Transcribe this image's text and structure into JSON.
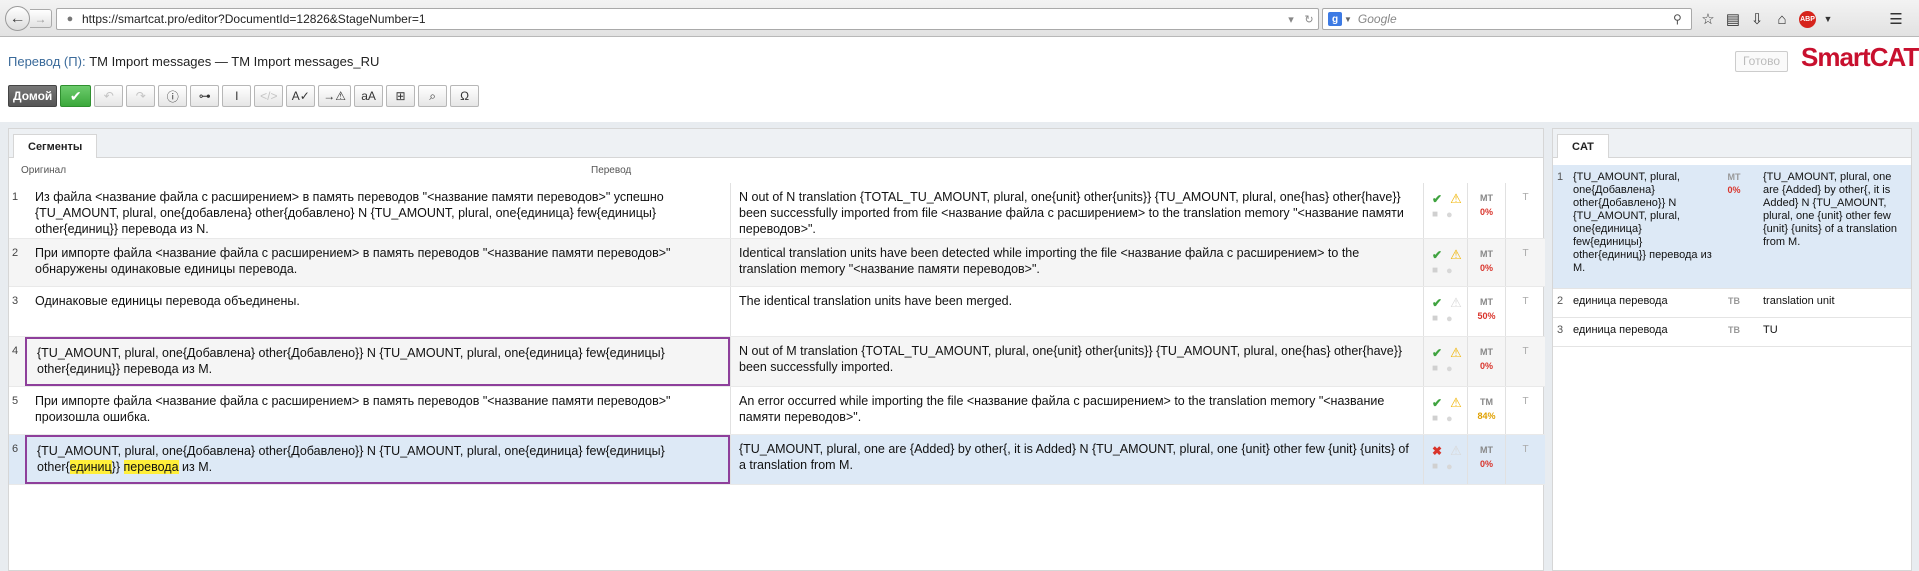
{
  "browser": {
    "url": "https://smartcat.pro/editor?DocumentId=12826&StageNumber=1",
    "search_placeholder": "Google",
    "search_engine_letter": "g",
    "addon_label": "ABP"
  },
  "header": {
    "mode_label": "Перевод (П):",
    "document_title": "TM Import messages — TM Import messages_RU",
    "done_label": "Готово",
    "logo_text": "SmartCAT"
  },
  "toolbar": {
    "home_label": "Домой",
    "confirm_icon": "checkmark-icon",
    "tools": [
      {
        "name": "undo-button",
        "glyph": "↶",
        "disabled": true
      },
      {
        "name": "redo-button",
        "glyph": "↷",
        "disabled": true
      },
      {
        "name": "info-button",
        "glyph": "ⓘ",
        "disabled": false
      },
      {
        "name": "key-button",
        "glyph": "⊶",
        "disabled": false
      },
      {
        "name": "insert-cursor-button",
        "glyph": "I",
        "disabled": false
      },
      {
        "name": "insert-tag-button",
        "glyph": "</>",
        "disabled": true
      },
      {
        "name": "spellcheck-button",
        "glyph": "A✓",
        "disabled": false
      },
      {
        "name": "qa-check-button",
        "glyph": "→⚠",
        "disabled": false
      },
      {
        "name": "change-case-button",
        "glyph": "aA",
        "disabled": false
      },
      {
        "name": "add-term-button",
        "glyph": "⊞",
        "disabled": false
      },
      {
        "name": "concordance-button",
        "glyph": "⌕",
        "disabled": false
      },
      {
        "name": "special-char-button",
        "glyph": "Ω",
        "disabled": false
      }
    ]
  },
  "segments_panel": {
    "tab_label": "Сегменты",
    "col_source": "Оригинал",
    "col_target": "Перевод",
    "rows": [
      {
        "num": "1",
        "source": "Из файла <название файла с расширением> в память переводов \"<название памяти переводов>\" успешно {TU_AMOUNT, plural, one{добавлена} other{добавлено} N {TU_AMOUNT, plural, one{единица} few{единицы} other{единиц}} перевода из N.",
        "target": "N out of N translation {TOTAL_TU_AMOUNT, plural, one{unit} other{units}} {TU_AMOUNT, plural, one{has} other{have}} been successfully imported from file <название файла с расширением> to the translation memory \"<название памяти переводов>\".",
        "status": "ok",
        "warning": true,
        "match_type": "MT",
        "match_value": "0%",
        "match_color": "red",
        "t": "T"
      },
      {
        "num": "2",
        "source": "При импорте файла <название файла с расширением> в память переводов \"<название памяти переводов>\" обнаружены одинаковые единицы перевода.",
        "target": "Identical translation units have been detected while importing the file <название файла с расширением> to the translation memory \"<название памяти переводов>\".",
        "status": "ok",
        "warning": true,
        "match_type": "MT",
        "match_value": "0%",
        "match_color": "red",
        "t": "T"
      },
      {
        "num": "3",
        "source": "Одинаковые единицы перевода объединены.",
        "target": "The identical translation units have been merged.",
        "status": "ok",
        "warning": false,
        "match_type": "MT",
        "match_value": "50%",
        "match_color": "red",
        "t": "T"
      },
      {
        "num": "4",
        "source": "{TU_AMOUNT, plural, one{Добавлена} other{Добавлено}} N {TU_AMOUNT, plural, one{единица} few{единицы} other{единиц}} перевода из M.",
        "target": "N out of M translation {TOTAL_TU_AMOUNT, plural, one{unit} other{units}} {TU_AMOUNT, plural, one{has} other{have}} been successfully imported.",
        "status": "ok",
        "warning": true,
        "match_type": "MT",
        "match_value": "0%",
        "match_color": "red",
        "t": "T"
      },
      {
        "num": "5",
        "source": "При импорте файла <название файла с расширением> в память переводов \"<название памяти переводов>\" произошла ошибка.",
        "target": "An error occurred while importing the file <название файла с расширением> to the translation memory \"<название памяти переводов>\".",
        "status": "ok",
        "warning": true,
        "match_type": "TM",
        "match_value": "84%",
        "match_color": "orange",
        "t": "T"
      },
      {
        "num": "6",
        "source_before": "{TU_AMOUNT, plural, one{Добавлена} other{Добавлено}} N {TU_AMOUNT, plural, one{единица} few{единицы} other{",
        "source_hl1": "единиц",
        "source_mid": "}} ",
        "source_hl2": "перевода",
        "source_after": " из M.",
        "target": "{TU_AMOUNT, plural, one are {Added} by other{, it is Added} N {TU_AMOUNT, plural, one {unit} other few {unit} {units} of a translation from M.",
        "status": "error",
        "warning": false,
        "match_type": "MT",
        "match_value": "0%",
        "match_color": "red",
        "t": "T"
      }
    ]
  },
  "cat_panel": {
    "tab_label": "CAT",
    "rows": [
      {
        "num": "1",
        "source": "{TU_AMOUNT, plural, one{Добавлена} other{Добавлено}} N {TU_AMOUNT, plural, one{единица} few{единицы} other{единиц}} перевода из M.",
        "type": "MT",
        "score": "0%",
        "target": "{TU_AMOUNT, plural, one are {Added} by other{, it is Added} N {TU_AMOUNT, plural, one {unit} other few {unit} {units} of a translation from M."
      },
      {
        "num": "2",
        "source": "единица перевода",
        "type": "TB",
        "score": "",
        "target": "translation unit"
      },
      {
        "num": "3",
        "source": "единица перевода",
        "type": "TB",
        "score": "",
        "target": "TU"
      }
    ]
  },
  "colors": {
    "accent_purple": "#8e3f9b",
    "logo_red": "#c8102e",
    "ok_green": "#3fa33f",
    "error_red": "#d9342b",
    "warn_yellow": "#f0b400",
    "highlight": "#ffef3a",
    "active_row": "#dde9f6"
  }
}
